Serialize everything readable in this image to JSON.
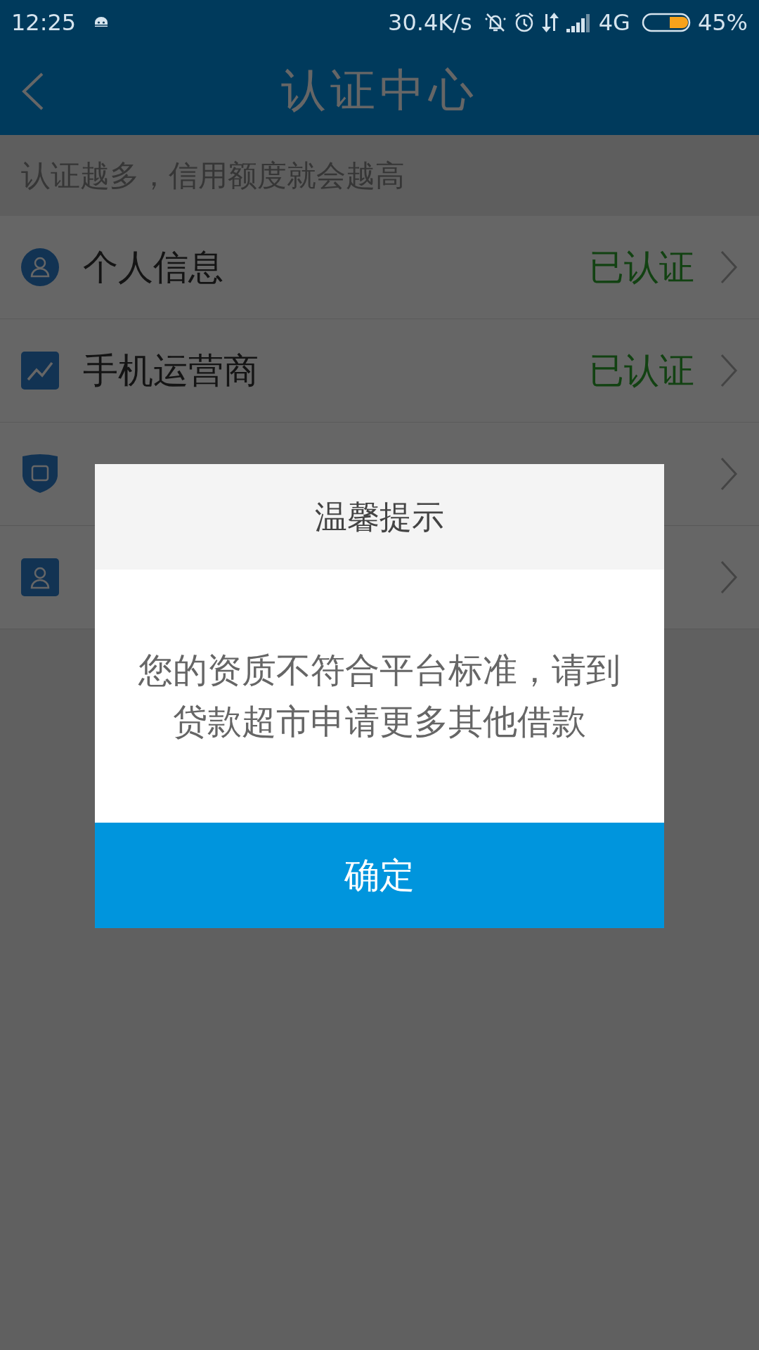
{
  "status_bar": {
    "time": "12:25",
    "speed": "30.4K/s",
    "network": "4G",
    "battery": "45%"
  },
  "header": {
    "title": "认证中心"
  },
  "subtitle": "认证越多，信用额度就会越高",
  "items": [
    {
      "kind": "full",
      "label": "个人信息",
      "status": "已认证",
      "verified": true
    },
    {
      "kind": "full",
      "label": "手机运营商",
      "status": "已认证",
      "verified": true
    },
    {
      "kind": "covered"
    },
    {
      "kind": "covered"
    }
  ],
  "dialog": {
    "title": "温馨提示",
    "message": "您的资质不符合平台标准，请到贷款超市申请更多其他借款",
    "button": "确定"
  }
}
